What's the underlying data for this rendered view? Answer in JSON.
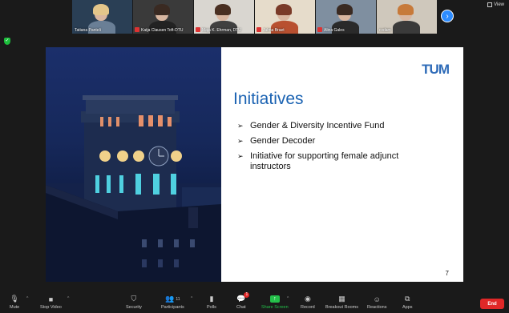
{
  "top": {
    "view_label": "View"
  },
  "participants": [
    {
      "name": "Tatiana Panteli",
      "bg": "#2a3f55",
      "hair": "#e3c58a",
      "body": "#6a7f96",
      "muted": false
    },
    {
      "name": "Katja Clausen Toft-DTU",
      "bg": "#3a3a3a",
      "hair": "#3a2a22",
      "body": "#222222",
      "muted": true
    },
    {
      "name": "Maja K. Ehrman, DTU",
      "bg": "#d9d6d0",
      "hair": "#4a3022",
      "body": "#404040",
      "muted": true
    },
    {
      "name": "Julma Braet",
      "bg": "#e6dccb",
      "hair": "#7a3a28",
      "body": "#b85030",
      "muted": true
    },
    {
      "name": "Alina Gales",
      "bg": "#7f8fa0",
      "hair": "#3a2a22",
      "body": "#2a2a2a",
      "muted": true
    },
    {
      "name": "cvdam",
      "bg": "#cfc8bc",
      "hair": "#c77a3a",
      "body": "#3a3a3a",
      "muted": false
    }
  ],
  "slide": {
    "logo": "TUM",
    "title": "Initiatives",
    "bullets": [
      "Gender & Diversity Incentive Fund",
      "Gender Decoder",
      "Initiative for supporting female adjunct instructors"
    ],
    "page_number": "7"
  },
  "toolbar": {
    "mute": "Mute",
    "stop_video": "Stop Video",
    "security": "Security",
    "participants": "Participants",
    "participants_count": "11",
    "polls": "Polls",
    "chat": "Chat",
    "chat_badge": "1",
    "share_screen": "Share Screen",
    "record": "Record",
    "breakout_rooms": "Breakout Rooms",
    "reactions": "Reactions",
    "apps": "Apps",
    "end": "End"
  },
  "colors": {
    "accent": "#2d8cff",
    "share_green": "#24c04a",
    "end_red": "#e02828",
    "tum_blue": "#1a62b2"
  }
}
